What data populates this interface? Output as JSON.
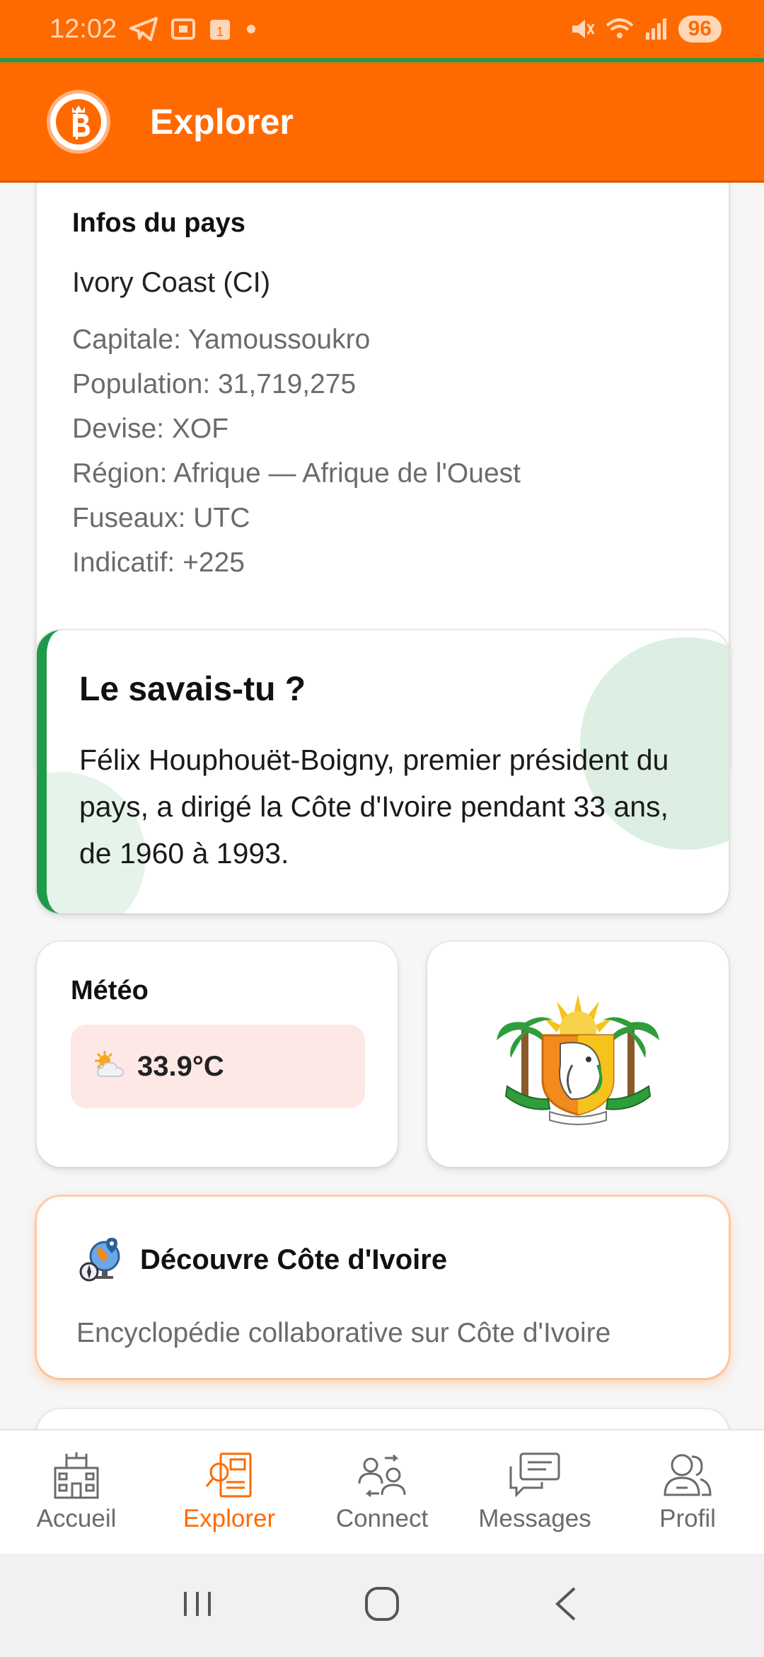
{
  "status_bar": {
    "time": "12:02",
    "battery": "96",
    "icons": [
      "telegram-icon",
      "screenshot-icon",
      "calendar-icon",
      "dot-icon",
      "mute-icon",
      "wifi-icon",
      "signal-icon",
      "battery-icon"
    ],
    "color": "#ff6a00"
  },
  "app_bar": {
    "title": "Explorer",
    "logo": "bitcoin-crown-logo",
    "color": "#ff6a00"
  },
  "country_info": {
    "title": "Infos du pays",
    "country": "Ivory Coast (CI)",
    "capital": "Capitale: Yamoussoukro",
    "population": "Population: 31,719,275",
    "currency": "Devise: XOF",
    "region": "Région: Afrique — Afrique de l'Ouest",
    "timezone": "Fuseaux: UTC",
    "dial_code": "Indicatif: +225"
  },
  "fact": {
    "title": "Le savais-tu ?",
    "text": "Félix Houphouët-Boigny, premier président du pays, a dirigé la Côte d'Ivoire pendant 33 ans, de 1960 à 1993.",
    "accent": "#1f9a4a"
  },
  "weather": {
    "title": "Météo",
    "temperature": "33.9°C",
    "icon": "sun-cloud-icon"
  },
  "emblem": {
    "icon": "ivory-coast-coat-of-arms"
  },
  "discover": {
    "title": "Découvre Côte d'Ivoire",
    "description": "Encyclopédie collaborative sur Côte d'Ivoire",
    "icon": "globe-compass-icon"
  },
  "bottom_nav": {
    "items": [
      {
        "label": "Accueil",
        "icon": "building-icon",
        "active": false
      },
      {
        "label": "Explorer",
        "icon": "explore-document-icon",
        "active": true
      },
      {
        "label": "Connect",
        "icon": "connect-users-icon",
        "active": false
      },
      {
        "label": "Messages",
        "icon": "chat-bubbles-icon",
        "active": false
      },
      {
        "label": "Profil",
        "icon": "profile-users-icon",
        "active": false
      }
    ],
    "active_color": "#ff6a00"
  },
  "system_nav": {
    "icons": [
      "recent-apps-icon",
      "home-icon",
      "back-icon"
    ]
  }
}
